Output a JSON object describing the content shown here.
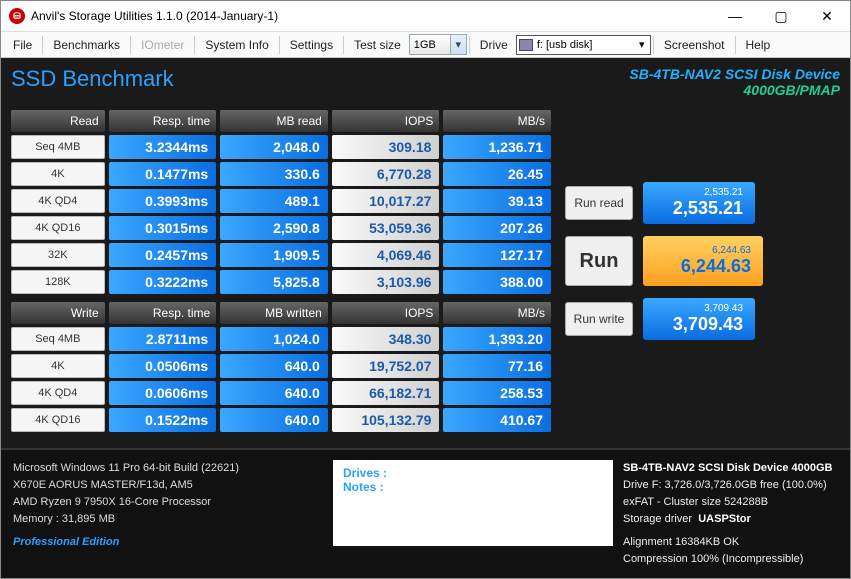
{
  "window": {
    "title": "Anvil's Storage Utilities 1.1.0 (2014-January-1)"
  },
  "menu": {
    "file": "File",
    "benchmarks": "Benchmarks",
    "iometer": "IOmeter",
    "systeminfo": "System Info",
    "settings": "Settings",
    "testsize_label": "Test size",
    "testsize_value": "1GB",
    "drive_label": "Drive",
    "drive_value": "f: [usb disk]",
    "screenshot": "Screenshot",
    "help": "Help"
  },
  "header": {
    "title": "SSD Benchmark",
    "device": "SB-4TB-NAV2 SCSI Disk Device",
    "device_spec": "4000GB/PMAP"
  },
  "read": {
    "title": "Read",
    "cols": [
      "Resp. time",
      "MB read",
      "IOPS",
      "MB/s"
    ],
    "rows": [
      {
        "label": "Seq 4MB",
        "resp": "3.2344ms",
        "mb": "2,048.0",
        "iops": "309.18",
        "mbs": "1,236.71"
      },
      {
        "label": "4K",
        "resp": "0.1477ms",
        "mb": "330.6",
        "iops": "6,770.28",
        "mbs": "26.45"
      },
      {
        "label": "4K QD4",
        "resp": "0.3993ms",
        "mb": "489.1",
        "iops": "10,017.27",
        "mbs": "39.13"
      },
      {
        "label": "4K QD16",
        "resp": "0.3015ms",
        "mb": "2,590.8",
        "iops": "53,059.36",
        "mbs": "207.26"
      },
      {
        "label": "32K",
        "resp": "0.2457ms",
        "mb": "1,909.5",
        "iops": "4,069.46",
        "mbs": "127.17"
      },
      {
        "label": "128K",
        "resp": "0.3222ms",
        "mb": "5,825.8",
        "iops": "3,103.96",
        "mbs": "388.00"
      }
    ]
  },
  "write": {
    "title": "Write",
    "cols": [
      "Resp. time",
      "MB written",
      "IOPS",
      "MB/s"
    ],
    "rows": [
      {
        "label": "Seq 4MB",
        "resp": "2.8711ms",
        "mb": "1,024.0",
        "iops": "348.30",
        "mbs": "1,393.20"
      },
      {
        "label": "4K",
        "resp": "0.0506ms",
        "mb": "640.0",
        "iops": "19,752.07",
        "mbs": "77.16"
      },
      {
        "label": "4K QD4",
        "resp": "0.0606ms",
        "mb": "640.0",
        "iops": "66,182.71",
        "mbs": "258.53"
      },
      {
        "label": "4K QD16",
        "resp": "0.1522ms",
        "mb": "640.0",
        "iops": "105,132.79",
        "mbs": "410.67"
      }
    ]
  },
  "buttons": {
    "run_read": "Run read",
    "run_write": "Run write",
    "run": "Run"
  },
  "scores": {
    "read_sm": "2,535.21",
    "read_lg": "2,535.21",
    "total_sm": "6,244.63",
    "total_lg": "6,244.63",
    "write_sm": "3,709.43",
    "write_lg": "3,709.43"
  },
  "footer": {
    "os": "Microsoft Windows 11 Pro 64-bit Build (22621)",
    "mobo": "X670E AORUS MASTER/F13d, AM5",
    "cpu": "AMD Ryzen 9 7950X 16-Core Processor",
    "mem": "Memory : 31,895 MB",
    "edition": "Professional Edition",
    "drives_label": "Drives :",
    "notes_label": "Notes :",
    "stor_device": "SB-4TB-NAV2 SCSI Disk Device 4000GB",
    "stor_drive": "Drive F: 3,726.0/3,726.0GB free (100.0%)",
    "stor_fs": "exFAT - Cluster size 524288B",
    "stor_driver_label": "Storage driver",
    "stor_driver": "UASPStor",
    "stor_align": "Alignment 16384KB OK",
    "stor_comp": "Compression 100% (Incompressible)"
  }
}
